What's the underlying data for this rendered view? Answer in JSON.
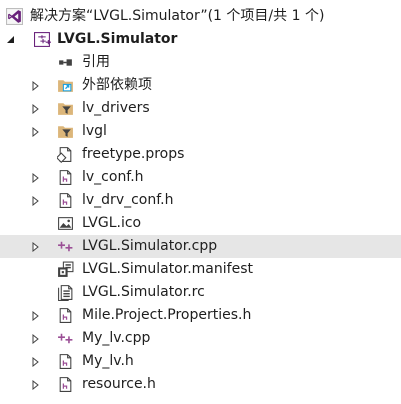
{
  "solution": {
    "label": "解决方案“LVGL.Simulator”(1 个项目/共 1 个)",
    "icon": "vs-solution-icon"
  },
  "project": {
    "label": "LVGL.Simulator",
    "icon": "cpp-project-icon",
    "expanded": true
  },
  "items": [
    {
      "label": "引用",
      "icon": "references-icon",
      "expandable": false
    },
    {
      "label": "外部依赖项",
      "icon": "external-dependencies-icon",
      "expandable": true
    },
    {
      "label": "lv_drivers",
      "icon": "filter-folder-icon",
      "expandable": true
    },
    {
      "label": "lvgl",
      "icon": "filter-folder-icon",
      "expandable": true
    },
    {
      "label": "freetype.props",
      "icon": "property-sheet-icon",
      "expandable": false
    },
    {
      "label": "lv_conf.h",
      "icon": "header-file-icon",
      "expandable": true
    },
    {
      "label": "lv_drv_conf.h",
      "icon": "header-file-icon",
      "expandable": true
    },
    {
      "label": "LVGL.ico",
      "icon": "image-file-icon",
      "expandable": false
    },
    {
      "label": "LVGL.Simulator.cpp",
      "icon": "cpp-file-icon",
      "expandable": true,
      "selected": true
    },
    {
      "label": "LVGL.Simulator.manifest",
      "icon": "manifest-file-icon",
      "expandable": false
    },
    {
      "label": "LVGL.Simulator.rc",
      "icon": "resource-file-icon",
      "expandable": false
    },
    {
      "label": "Mile.Project.Properties.h",
      "icon": "header-file-icon",
      "expandable": true
    },
    {
      "label": "My_lv.cpp",
      "icon": "cpp-file-icon",
      "expandable": true
    },
    {
      "label": "My_lv.h",
      "icon": "header-file-icon",
      "expandable": true
    },
    {
      "label": "resource.h",
      "icon": "header-file-icon",
      "expandable": true
    }
  ],
  "colors": {
    "vs_purple": "#68217a",
    "cpp_purple": "#9b4f96",
    "folder_yellow": "#dcb67a",
    "ext_blue": "#1ba1e2",
    "selected_bg": "#e6e6e6",
    "icon_gray": "#424242"
  }
}
